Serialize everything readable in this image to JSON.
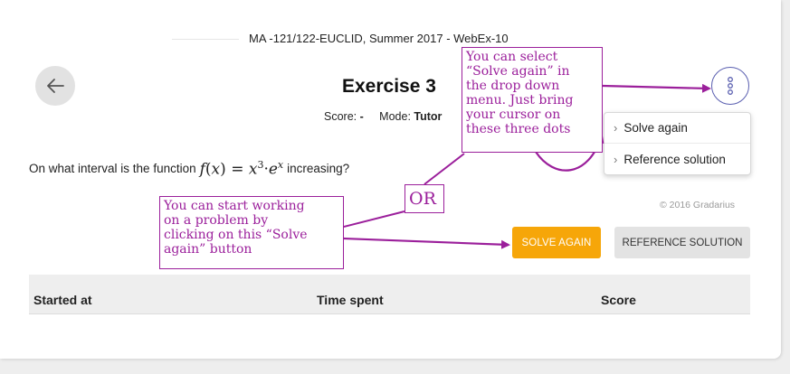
{
  "header": {
    "course": "MA -121/122-EUCLID, Summer 2017 - WebEx-10",
    "title": "Exercise 3",
    "score_label": "Score:",
    "score_value": "-",
    "mode_label": "Mode:",
    "mode_value": "Tutor"
  },
  "question": {
    "prefix": "On what interval is the function",
    "suffix": "increasing?"
  },
  "menu": {
    "items": [
      "Solve again",
      "Reference solution"
    ]
  },
  "footer": {
    "copyright": "© 2016 Gradarius"
  },
  "buttons": {
    "solve_again": "SOLVE AGAIN",
    "reference_solution": "REFERENCE SOLUTION"
  },
  "table": {
    "columns": [
      "Started at",
      "Time spent",
      "Score"
    ]
  },
  "annotations": {
    "note1": [
      "You can select",
      "“Solve again” in",
      "the drop down",
      "menu. Just bring",
      "your cursor on",
      "these three dots"
    ],
    "note2": [
      "You can start working",
      "on a problem by",
      "clicking on this “Solve",
      "again” button"
    ],
    "or_label": "OR"
  },
  "colors": {
    "accent": "#f6a609",
    "annotation": "#9b1f9b",
    "more_button": "#5a5fb0"
  }
}
